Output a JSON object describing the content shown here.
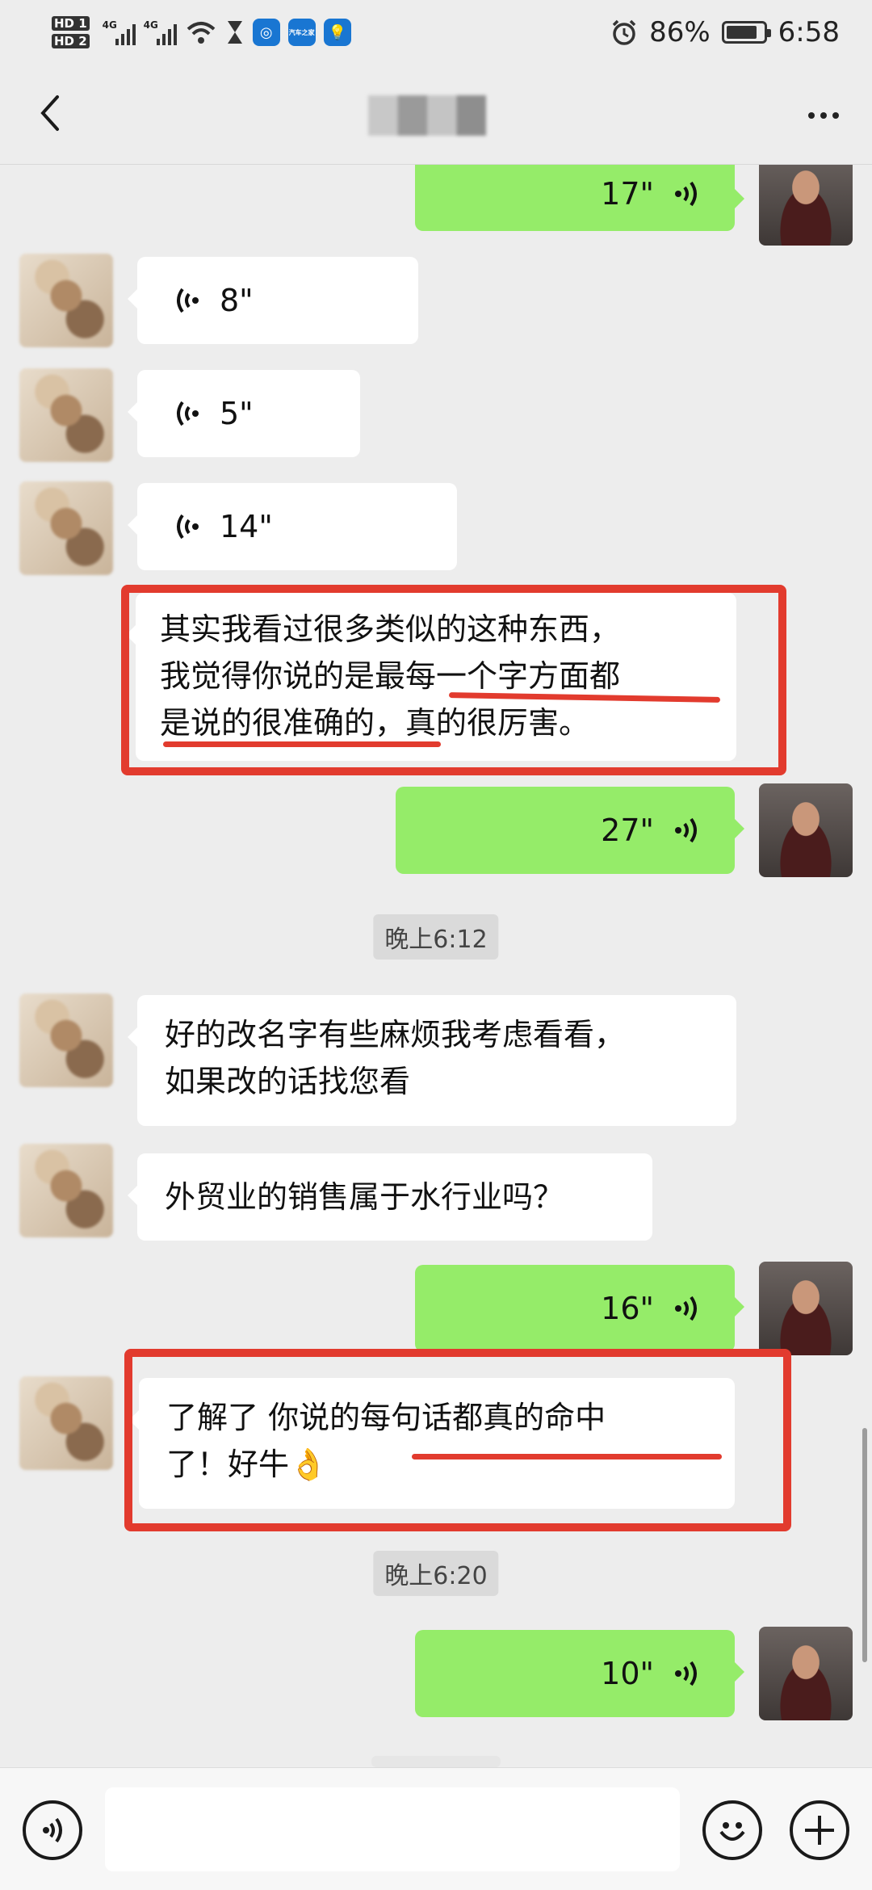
{
  "status_bar": {
    "hd1": "HD 1",
    "hd2": "HD 2",
    "net1": "4G",
    "net2": "4G",
    "app_label": "汽车之家",
    "battery_percent": 86,
    "battery_text": "86%",
    "time": "6:58"
  },
  "header": {
    "back_icon": "chevron-left-icon",
    "more_icon": "more-dots-icon"
  },
  "messages": {
    "m1": {
      "side": "out",
      "type": "voice",
      "duration": "17\""
    },
    "m2": {
      "side": "in",
      "type": "voice",
      "duration": "8\""
    },
    "m3": {
      "side": "in",
      "type": "voice",
      "duration": "5\""
    },
    "m4": {
      "side": "in",
      "type": "voice",
      "duration": "14\""
    },
    "m5": {
      "side": "in",
      "type": "text",
      "lines": [
        "其实我看过很多类似的这种东西，",
        "我觉得你说的是最每一个字方面都",
        "是说的很准确的，真的很厉害。"
      ]
    },
    "m6": {
      "side": "out",
      "type": "voice",
      "duration": "27\""
    },
    "t1": {
      "type": "timestamp",
      "text": "晚上6:12"
    },
    "m7": {
      "side": "in",
      "type": "text",
      "lines": [
        "好的改名字有些麻烦我考虑看看，",
        "如果改的话找您看"
      ]
    },
    "m8": {
      "side": "in",
      "type": "text",
      "lines": [
        "外贸业的销售属于水行业吗？"
      ]
    },
    "m9": {
      "side": "out",
      "type": "voice",
      "duration": "16\""
    },
    "m10": {
      "side": "in",
      "type": "text",
      "lines": [
        "了解了 你说的每句话都真的命中",
        "了！好牛👌"
      ]
    },
    "t2": {
      "type": "timestamp",
      "text": "晚上6:20"
    },
    "m11": {
      "side": "out",
      "type": "voice",
      "duration": "10\""
    }
  },
  "colors": {
    "self_bubble": "#95ec69",
    "other_bubble": "#ffffff",
    "annotation_red": "#e23b2e",
    "background": "#ededed"
  },
  "input_bar": {
    "voice_icon": "voice-mode-icon",
    "input_value": "",
    "emoji_icon": "emoji-icon",
    "plus_icon": "plus-icon"
  }
}
